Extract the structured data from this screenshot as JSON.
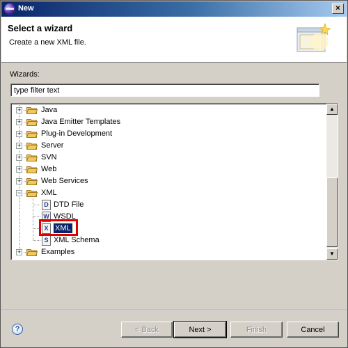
{
  "window": {
    "title": "New",
    "close_label": "×"
  },
  "header": {
    "title": "Select a wizard",
    "description": "Create a new XML file."
  },
  "wizards_label": "Wizards:",
  "filter": {
    "value": "type filter text"
  },
  "tree": {
    "items": [
      {
        "label": "Java",
        "expander": "+"
      },
      {
        "label": "Java Emitter Templates",
        "expander": "+"
      },
      {
        "label": "Plug-in Development",
        "expander": "+"
      },
      {
        "label": "Server",
        "expander": "+"
      },
      {
        "label": "SVN",
        "expander": "+"
      },
      {
        "label": "Web",
        "expander": "+"
      },
      {
        "label": "Web Services",
        "expander": "+"
      },
      {
        "label": "XML",
        "expander": "−",
        "children": [
          {
            "label": "DTD File",
            "icon": "D"
          },
          {
            "label": "WSDL",
            "icon": "W"
          },
          {
            "label": "XML",
            "icon": "X",
            "selected": true
          },
          {
            "label": "XML Schema",
            "icon": "S"
          }
        ]
      },
      {
        "label": "Examples",
        "expander": "+"
      }
    ]
  },
  "buttons": {
    "back": "< Back",
    "next": "Next >",
    "finish": "Finish",
    "cancel": "Cancel",
    "help": "?"
  },
  "colors": {
    "selection": "#0a246a",
    "highlight": "#e00000",
    "folder": "#f0c860"
  },
  "icons": {
    "folder": "folder-icon",
    "help": "help-icon",
    "close": "close-icon"
  }
}
